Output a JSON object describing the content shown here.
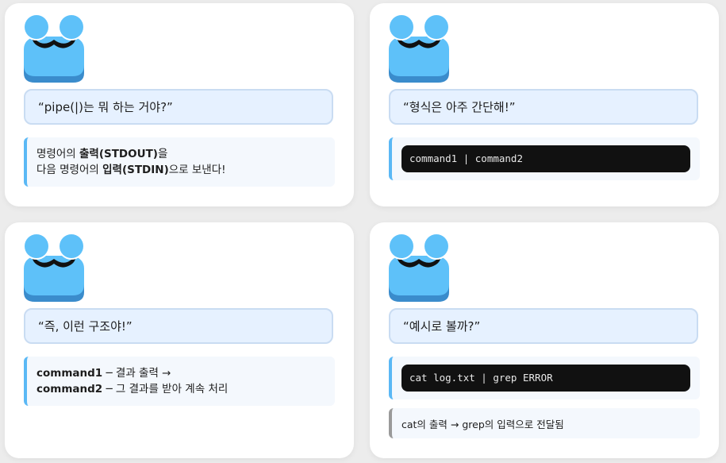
{
  "colors": {
    "mascot_blue": "#5ec1f9",
    "mascot_dark_blue": "#3a8ccc",
    "bubble_bg": "#e6f1ff",
    "accent_bar": "#5ab8f5",
    "code_bg": "#111111"
  },
  "cards": [
    {
      "bubble": "“pipe(|)는 뭐 하는 거야?”",
      "line1_pre": "명령어의 ",
      "line1_bold": "출력(STDOUT)",
      "line1_post": "을",
      "line2_pre": "다음 명령어의 ",
      "line2_bold": "입력(STDIN)",
      "line2_post": "으로 보낸다!"
    },
    {
      "bubble": "“형식은 아주 간단해!”",
      "code": "command1 | command2"
    },
    {
      "bubble": "“즉, 이런 구조야!”",
      "line1_bold": "command1",
      "line1_post": " ─ 결과 출력 →",
      "line2_bold": "command2",
      "line2_post": " ─ 그 결과를 받아 계속 처리"
    },
    {
      "bubble": "“예시로 볼까?”",
      "code": "cat log.txt | grep ERROR",
      "note": "cat의 출력 → grep의 입력으로 전달됨"
    }
  ]
}
